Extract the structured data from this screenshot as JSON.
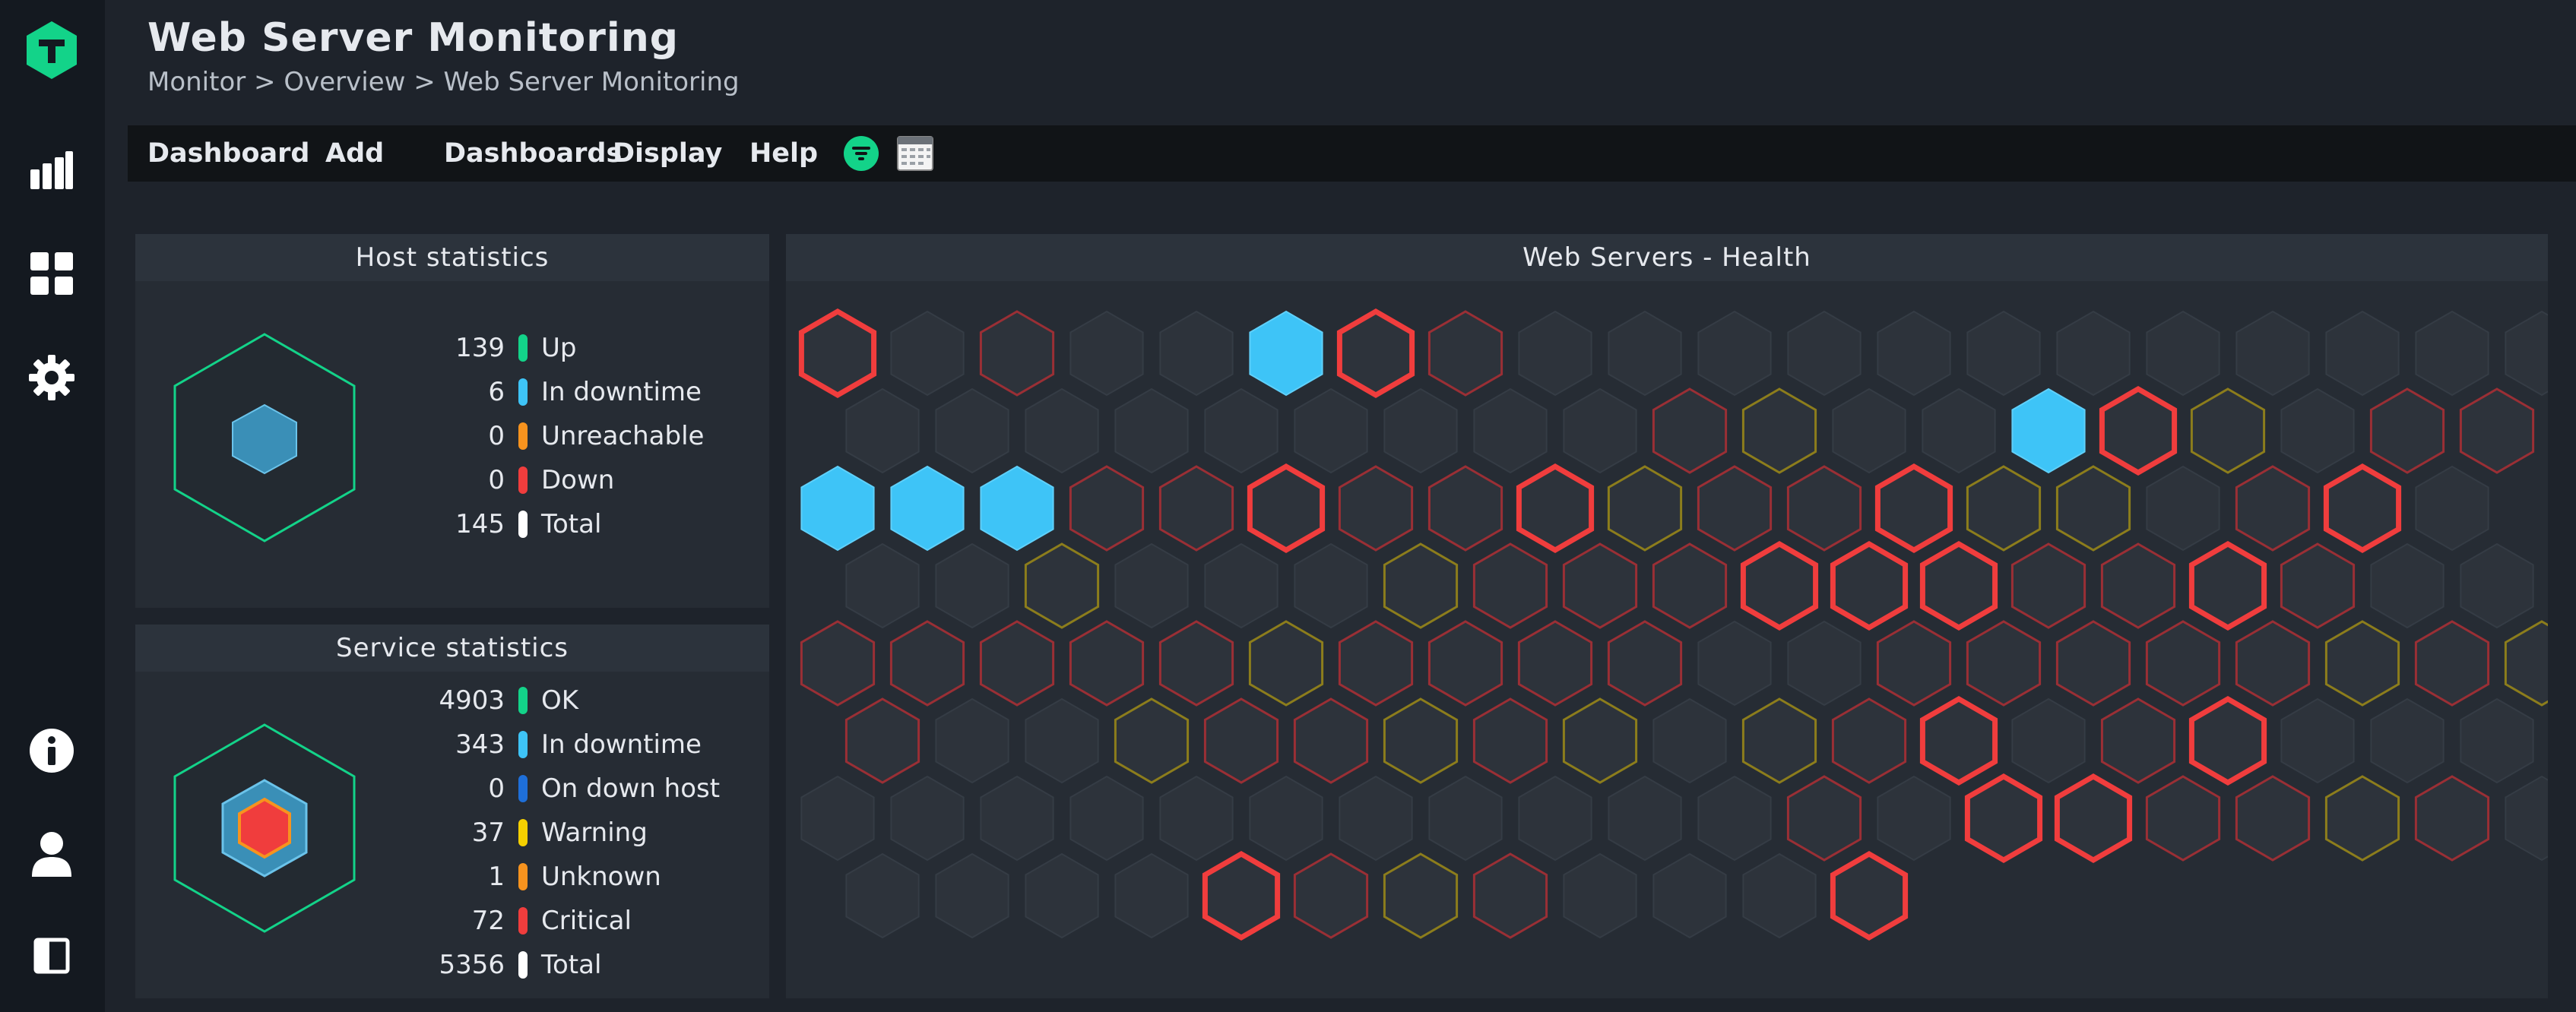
{
  "app": {
    "title": "Web Server Monitoring"
  },
  "breadcrumb": {
    "text": "Monitor > Overview > Web Server Monitoring"
  },
  "menu": {
    "items": [
      "Dashboard",
      "Add",
      "Dashboards",
      "Display",
      "Help"
    ],
    "icons": [
      "filter-icon",
      "calendar-icon"
    ]
  },
  "sidebar": {
    "icons": [
      "logo-icon",
      "monitor-chart-icon",
      "dashboard-grid-icon",
      "settings-gear-icon",
      "info-icon",
      "user-icon",
      "sidebar-toggle-icon"
    ]
  },
  "host_statistics": {
    "title": "Host statistics",
    "rows": [
      {
        "value": "139",
        "label": "Up",
        "color": "#13d389"
      },
      {
        "value": "6",
        "label": "In downtime",
        "color": "#3ec4f7"
      },
      {
        "value": "0",
        "label": "Unreachable",
        "color": "#f7931e"
      },
      {
        "value": "0",
        "label": "Down",
        "color": "#f03d3d"
      },
      {
        "value": "145",
        "label": "Total",
        "color": "#ffffff"
      }
    ]
  },
  "service_statistics": {
    "title": "Service statistics",
    "rows": [
      {
        "value": "4903",
        "label": "OK",
        "color": "#13d389"
      },
      {
        "value": "343",
        "label": "In downtime",
        "color": "#3ec4f7"
      },
      {
        "value": "0",
        "label": "On down host",
        "color": "#1e6fd9"
      },
      {
        "value": "37",
        "label": "Warning",
        "color": "#f5d000"
      },
      {
        "value": "1",
        "label": "Unknown",
        "color": "#f7931e"
      },
      {
        "value": "72",
        "label": "Critical",
        "color": "#f03d3d"
      },
      {
        "value": "5356",
        "label": "Total",
        "color": "#ffffff"
      }
    ]
  },
  "health": {
    "title": "Web Servers - Health",
    "legend_codes": {
      "o": "ok",
      "d": "in-downtime",
      "c": "critical",
      "w": "warning",
      "r": "critical-outline",
      "y": "warning-outline"
    },
    "rows": [
      "coroodcroooooooooooo",
      "oooooooooryoodcyorrd",
      "dddrrcrrcyrrcyyorco",
      "ooyoooyrrrcccrrcroo",
      "rrrrryrrrroorrrrryry",
      "rooyrryryoyrcorcooo",
      "oooooooooooroccrryro",
      "oooocryroooc"
    ]
  },
  "colors": {
    "accent": "#13d389",
    "background": "#1e232b",
    "sidebar": "#141920",
    "panel": "#262c34",
    "downtime": "#3ec4f7",
    "critical": "#f03d3d",
    "warning": "#c8b400"
  }
}
